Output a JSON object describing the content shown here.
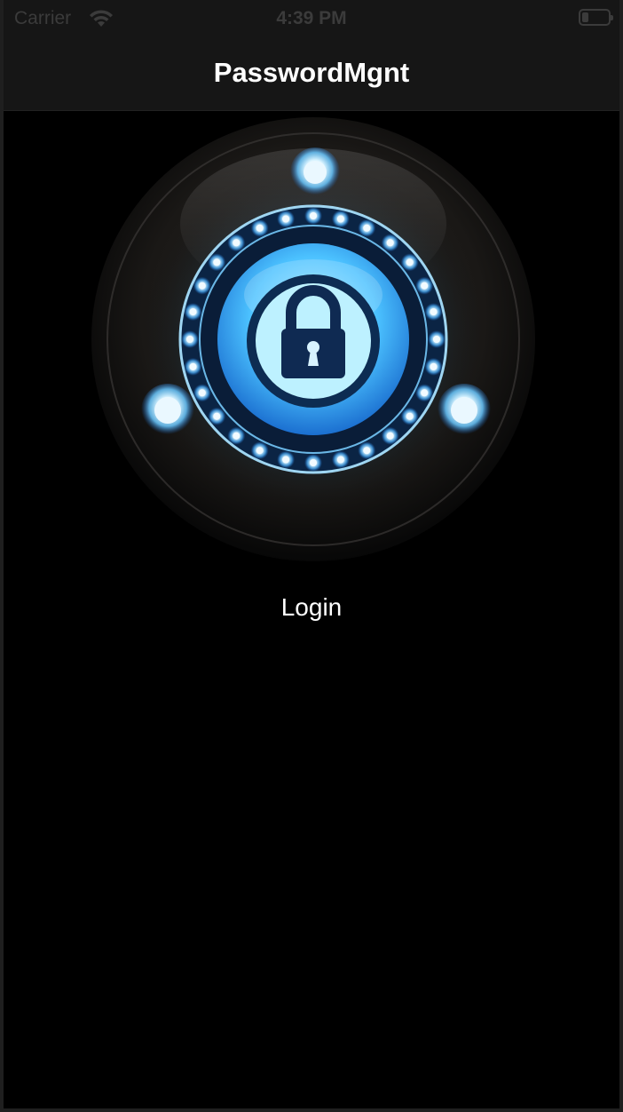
{
  "status_bar": {
    "carrier": "Carrier",
    "time": "4:39 PM",
    "battery_level_fraction": 0.15
  },
  "nav": {
    "title": "PasswordMgnt"
  },
  "hero": {
    "icon": "padlock-icon"
  },
  "login": {
    "label": "Login"
  },
  "colors": {
    "background": "#000000",
    "nav_background": "#161616",
    "accent_glow": "#4fc3ff",
    "text": "#ffffff"
  }
}
